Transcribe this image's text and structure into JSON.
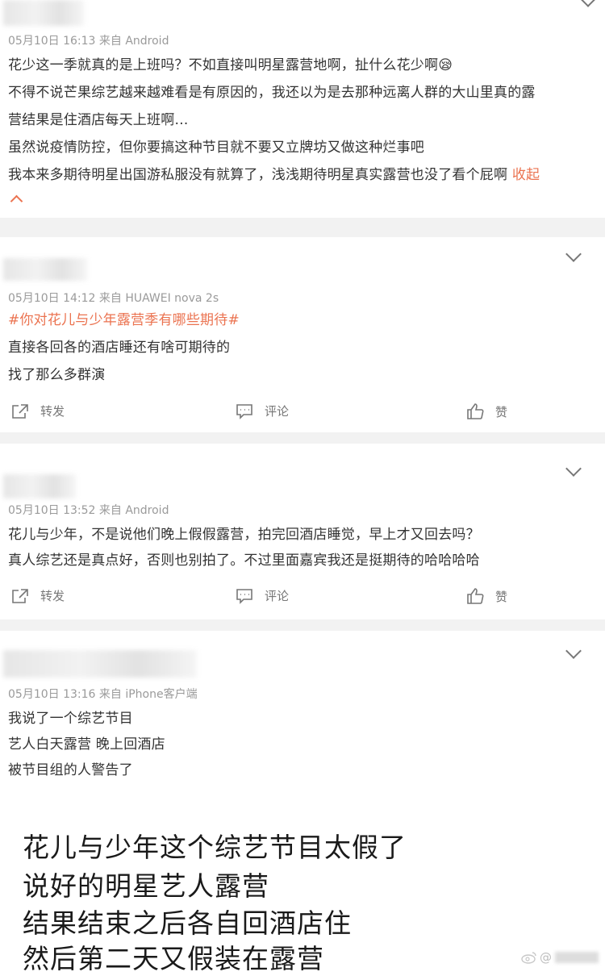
{
  "comments": [
    {
      "meta": "05月10日 16:13  来自 Android",
      "lines": [
        "花少这一季就真的是上班吗？不如直接叫明星露营地啊，扯什么花少啊😪",
        "不得不说芒果综艺越来越难看是有原因的，我还以为是去那种远离人群的大山里真的露",
        "营结果是住酒店每天上班啊…",
        "虽然说疫情防控，但你要搞这种节目就不要又立牌坊又做这种烂事吧",
        "我本来多期待明星出国游私服没有就算了，浅浅期待明星真实露营也没了看个屁啊"
      ],
      "collapse": "收起"
    },
    {
      "meta": "05月10日 14:12  来自 HUAWEI nova 2s",
      "topic": "#你对花儿与少年露营季有哪些期待#",
      "lines": [
        "直接各回各的酒店睡还有啥可期待的",
        "找了那么多群演"
      ]
    },
    {
      "meta": "05月10日 13:52  来自 Android",
      "lines": [
        "花儿与少年，不是说他们晚上假假露营，拍完回酒店睡觉，早上才又回去吗？",
        "真人综艺还是真点好，否则也别拍了。不过里面嘉宾我还是挺期待的哈哈哈哈"
      ]
    },
    {
      "meta": "05月10日 13:16  来自 iPhone客户端",
      "lines": [
        "我说了一个综艺节目",
        "艺人白天露营 晚上回酒店",
        "被节目组的人警告了"
      ]
    }
  ],
  "actions": {
    "repost": "转发",
    "comment": "评论",
    "like": "赞"
  },
  "caption": [
    "花儿与少年这个综艺节目太假了",
    "说好的明星艺人露营",
    "结果结束之后各自回酒店住",
    "然后第二天又假装在露营"
  ],
  "watermark": "@",
  "colors": {
    "accent": "#eb7350",
    "meta": "#9a9a9a",
    "separator": "#f2f2f2"
  }
}
